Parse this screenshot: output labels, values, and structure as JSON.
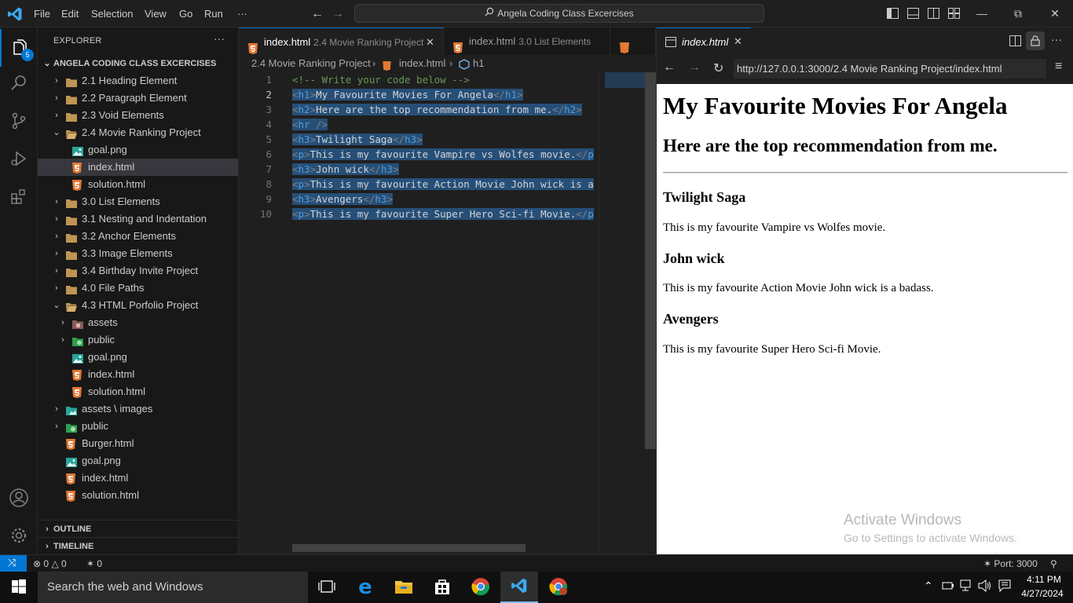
{
  "titlebar": {
    "menus": [
      "File",
      "Edit",
      "Selection",
      "View",
      "Go",
      "Run",
      "···"
    ],
    "command_center": "Angela Coding Class Excercises",
    "win_controls": [
      "minimize",
      "restore",
      "close"
    ]
  },
  "activity": {
    "explorer_badge": "5"
  },
  "sidebar": {
    "title": "EXPLORER",
    "more": "···",
    "root": "ANGELA CODING CLASS EXCERCISES",
    "items": [
      {
        "label": "2.1 Heading Element",
        "type": "folder",
        "depth": 0,
        "expanded": false
      },
      {
        "label": "2.2 Paragraph Element",
        "type": "folder",
        "depth": 0,
        "expanded": false
      },
      {
        "label": "2.3 Void Elements",
        "type": "folder",
        "depth": 0,
        "expanded": false
      },
      {
        "label": "2.4 Movie Ranking Project",
        "type": "folder",
        "depth": 0,
        "expanded": true
      },
      {
        "label": "goal.png",
        "type": "image",
        "depth": 1
      },
      {
        "label": "index.html",
        "type": "html",
        "depth": 1,
        "selected": true
      },
      {
        "label": "solution.html",
        "type": "html",
        "depth": 1
      },
      {
        "label": "3.0 List Elements",
        "type": "folder",
        "depth": 0,
        "expanded": false
      },
      {
        "label": "3.1 Nesting and Indentation",
        "type": "folder",
        "depth": 0,
        "expanded": false
      },
      {
        "label": "3.2 Anchor Elements",
        "type": "folder",
        "depth": 0,
        "expanded": false
      },
      {
        "label": "3.3 Image Elements",
        "type": "folder",
        "depth": 0,
        "expanded": false
      },
      {
        "label": "3.4 Birthday Invite Project",
        "type": "folder",
        "depth": 0,
        "expanded": false
      },
      {
        "label": "4.0 File Paths",
        "type": "folder",
        "depth": 0,
        "expanded": false
      },
      {
        "label": "4.3 HTML Porfolio Project",
        "type": "folder",
        "depth": 0,
        "expanded": true
      },
      {
        "label": "assets",
        "type": "assets",
        "depth": 1,
        "expanded": false
      },
      {
        "label": "public",
        "type": "public",
        "depth": 1,
        "expanded": false
      },
      {
        "label": "goal.png",
        "type": "image",
        "depth": 1
      },
      {
        "label": "index.html",
        "type": "html",
        "depth": 1
      },
      {
        "label": "solution.html",
        "type": "html",
        "depth": 1
      },
      {
        "label": "assets \\ images",
        "type": "images",
        "depth": 0,
        "expanded": false
      },
      {
        "label": "public",
        "type": "public",
        "depth": 0,
        "expanded": false
      },
      {
        "label": "Burger.html",
        "type": "html",
        "depth": 0
      },
      {
        "label": "goal.png",
        "type": "image",
        "depth": 0
      },
      {
        "label": "index.html",
        "type": "html",
        "depth": 0
      },
      {
        "label": "solution.html",
        "type": "html",
        "depth": 0
      }
    ],
    "outline": "OUTLINE",
    "timeline": "TIMELINE"
  },
  "editor": {
    "tabs": [
      {
        "name": "index.html",
        "desc": "2.4 Movie Ranking Project",
        "active": true
      },
      {
        "name": "index.html",
        "desc": "3.0 List Elements",
        "active": false
      }
    ],
    "breadcrumb": [
      "2.4 Movie Ranking Project",
      "index.html",
      "h1"
    ],
    "lines": [
      {
        "n": "1",
        "tokens": [
          {
            "t": "<!-- Write your code below -->",
            "c": "comment"
          }
        ]
      },
      {
        "n": "2",
        "tokens": [
          {
            "t": "<",
            "c": "br"
          },
          {
            "t": "h1",
            "c": "tag"
          },
          {
            "t": ">",
            "c": "br"
          },
          {
            "t": "My Favourite Movies For Angela",
            "c": "text"
          },
          {
            "t": "</",
            "c": "br"
          },
          {
            "t": "h1",
            "c": "tag"
          },
          {
            "t": ">",
            "c": "br"
          }
        ]
      },
      {
        "n": "3",
        "tokens": [
          {
            "t": "<",
            "c": "br"
          },
          {
            "t": "h2",
            "c": "tag"
          },
          {
            "t": ">",
            "c": "br"
          },
          {
            "t": "Here are the top recommendation from me.",
            "c": "text"
          },
          {
            "t": "</",
            "c": "br"
          },
          {
            "t": "h2",
            "c": "tag"
          },
          {
            "t": ">",
            "c": "br"
          }
        ]
      },
      {
        "n": "4",
        "tokens": [
          {
            "t": "<",
            "c": "br"
          },
          {
            "t": "hr",
            "c": "tag"
          },
          {
            "t": " />",
            "c": "br"
          }
        ]
      },
      {
        "n": "5",
        "tokens": [
          {
            "t": "<",
            "c": "br"
          },
          {
            "t": "h3",
            "c": "tag"
          },
          {
            "t": ">",
            "c": "br"
          },
          {
            "t": "Twilight Saga",
            "c": "text"
          },
          {
            "t": "</",
            "c": "br"
          },
          {
            "t": "h3",
            "c": "tag"
          },
          {
            "t": ">",
            "c": "br"
          }
        ]
      },
      {
        "n": "6",
        "tokens": [
          {
            "t": "<",
            "c": "br"
          },
          {
            "t": "p",
            "c": "tag"
          },
          {
            "t": ">",
            "c": "br"
          },
          {
            "t": "This is my favourite Vampire vs Wolfes movie.",
            "c": "text"
          },
          {
            "t": "</",
            "c": "br"
          },
          {
            "t": "p",
            "c": "tag"
          }
        ]
      },
      {
        "n": "7",
        "tokens": [
          {
            "t": "<",
            "c": "br"
          },
          {
            "t": "h3",
            "c": "tag"
          },
          {
            "t": ">",
            "c": "br"
          },
          {
            "t": "John wick",
            "c": "text"
          },
          {
            "t": "</",
            "c": "br"
          },
          {
            "t": "h3",
            "c": "tag"
          },
          {
            "t": ">",
            "c": "br"
          }
        ]
      },
      {
        "n": "8",
        "tokens": [
          {
            "t": "<",
            "c": "br"
          },
          {
            "t": "p",
            "c": "tag"
          },
          {
            "t": ">",
            "c": "br"
          },
          {
            "t": "This is my favourite Action Movie John wick is a",
            "c": "text"
          }
        ]
      },
      {
        "n": "9",
        "tokens": [
          {
            "t": "<",
            "c": "br"
          },
          {
            "t": "h3",
            "c": "tag"
          },
          {
            "t": ">",
            "c": "br"
          },
          {
            "t": "Avengers",
            "c": "text"
          },
          {
            "t": "</",
            "c": "br"
          },
          {
            "t": "h3",
            "c": "tag"
          },
          {
            "t": ">",
            "c": "br"
          }
        ]
      },
      {
        "n": "10",
        "tokens": [
          {
            "t": "<",
            "c": "br"
          },
          {
            "t": "p",
            "c": "tag"
          },
          {
            "t": ">",
            "c": "br"
          },
          {
            "t": "This is my favourite Super Hero Sci-fi Movie.",
            "c": "text"
          },
          {
            "t": "</",
            "c": "br"
          },
          {
            "t": "p",
            "c": "tag"
          }
        ]
      }
    ],
    "active_line": "2"
  },
  "preview": {
    "tab_title": "index.html",
    "url": "http://127.0.0.1:3000/2.4 Movie Ranking Project/index.html",
    "page": {
      "h1": "My Favourite Movies For Angela",
      "h2": "Here are the top recommendation from me.",
      "movies": [
        {
          "title": "Twilight Saga",
          "desc": "This is my favourite Vampire vs Wolfes movie."
        },
        {
          "title": "John wick",
          "desc": "This is my favourite Action Movie John wick is a badass."
        },
        {
          "title": "Avengers",
          "desc": "This is my favourite Super Hero Sci-fi Movie."
        }
      ]
    },
    "watermark": {
      "line1": "Activate Windows",
      "line2": "Go to Settings to activate Windows."
    }
  },
  "statusbar": {
    "errors": "0",
    "warnings": "0",
    "ports_count": "0",
    "port": "Port: 3000"
  },
  "taskbar": {
    "search_placeholder": "Search the web and Windows",
    "time": "4:11 PM",
    "date": "4/27/2024"
  },
  "colors": {
    "accent": "#0078d4",
    "html_icon": "#e37933",
    "folder_icon": "#c09553",
    "selection": "#264f78"
  }
}
